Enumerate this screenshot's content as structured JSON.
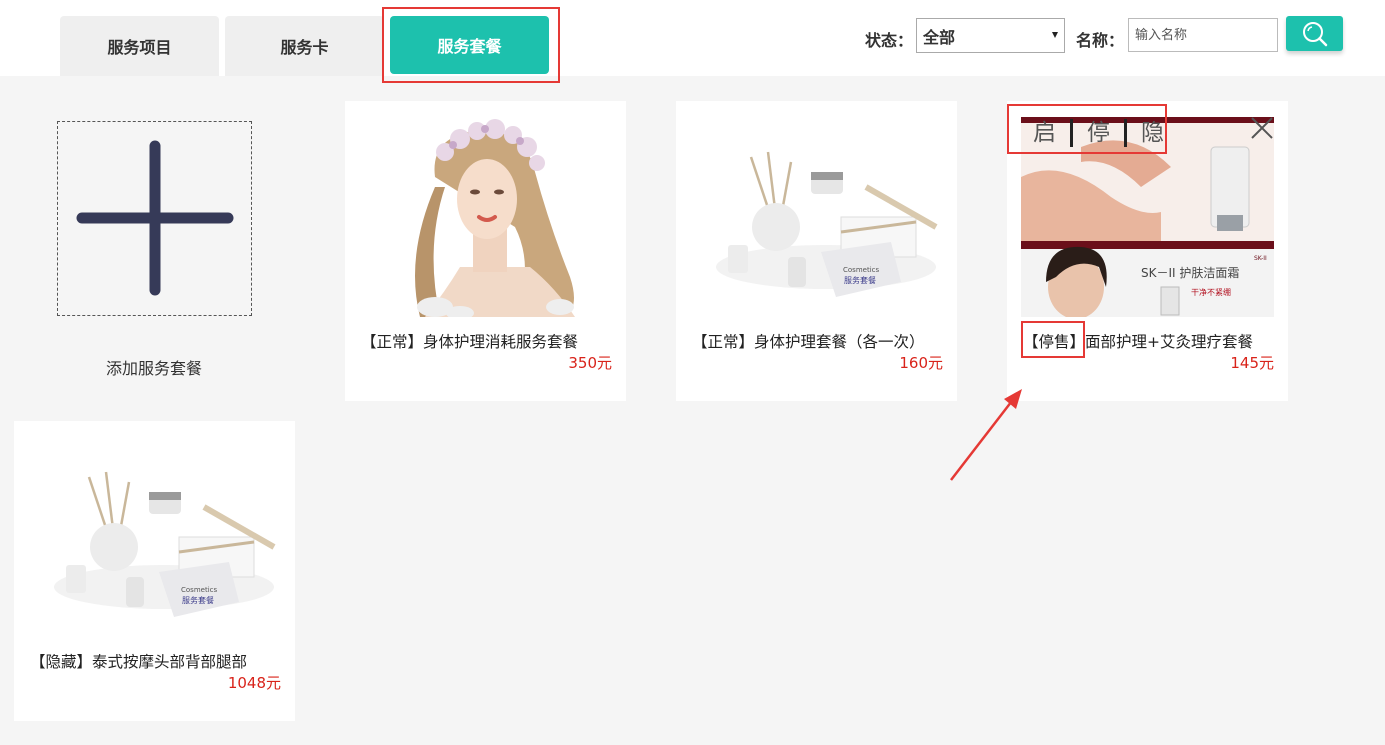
{
  "tabs": [
    {
      "label": "服务项目",
      "active": false
    },
    {
      "label": "服务卡",
      "active": false
    },
    {
      "label": "服务套餐",
      "active": true
    }
  ],
  "filter": {
    "status_label": "状态：",
    "status_value": "全部",
    "name_label": "名称：",
    "name_placeholder": "输入名称"
  },
  "add_card": {
    "label": "添加服务套餐"
  },
  "cards": [
    {
      "title": "【正常】身体护理消耗服务套餐",
      "price": "350元",
      "image": "woman-flower-crown"
    },
    {
      "title": "【正常】身体护理套餐（各一次）",
      "price": "160元",
      "image": "cosmetics-set"
    },
    {
      "title": "面部护理+艾灸理疗套餐",
      "status_tag": "【停售】",
      "price": "145元",
      "image": "skii-ad",
      "actions": {
        "enable": "启",
        "stop": "停",
        "hide": "隐"
      },
      "ad_text": {
        "brand": "SK-II",
        "headline": "SK－II 护肤洁面霜",
        "tagline": "干净不紧绷"
      }
    },
    {
      "title": "【隐藏】泰式按摩头部背部腿部",
      "price": "1048元",
      "image": "cosmetics-set"
    }
  ],
  "cosmetics_label": {
    "small": "Cosmetics",
    "big": "服务套餐"
  },
  "colors": {
    "accent": "#1dc1ad",
    "price": "#d9231a",
    "highlight": "#e53935"
  }
}
